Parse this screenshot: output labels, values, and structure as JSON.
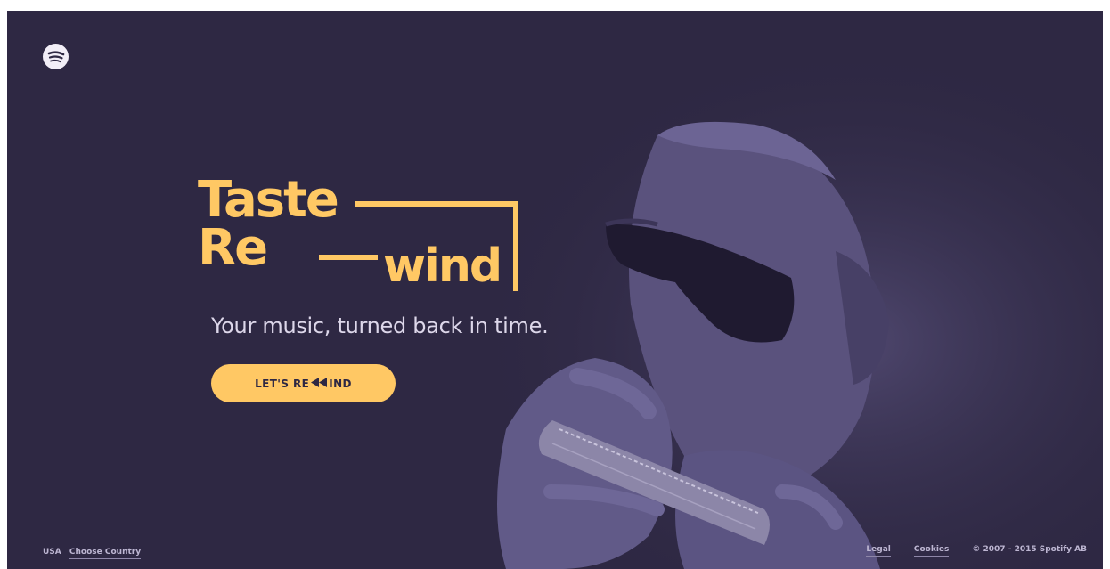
{
  "brand": {
    "logo_icon": "spotify-logo-icon"
  },
  "hero": {
    "title_line1": "Taste",
    "title_line2": "Re",
    "title_line3": "wind",
    "subtitle": "Your music, turned back in time.",
    "cta_prefix": "LET'S RE",
    "cta_icon": "rewind-icon",
    "cta_suffix": "IND"
  },
  "footer": {
    "country_code": "USA",
    "choose_country": "Choose Country",
    "legal": "Legal",
    "cookies": "Cookies",
    "copyright": "© 2007 - 2015 Spotify AB"
  },
  "colors": {
    "background": "#2e2843",
    "accent": "#ffc864",
    "photo_tint": "#5e5683",
    "text_light": "#ddd7ea"
  }
}
